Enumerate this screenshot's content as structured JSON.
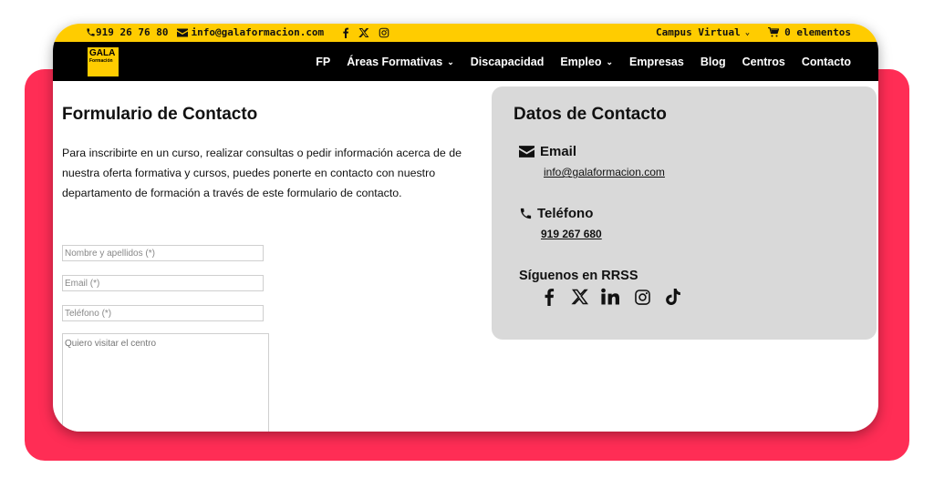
{
  "topbar": {
    "phone": "919 26 76 80",
    "email": "info@galaformacion.com",
    "campus": "Campus Virtual",
    "cart": "0 elementos"
  },
  "logo": {
    "line1": "GALA",
    "line2": "Formación"
  },
  "nav": {
    "items": [
      {
        "label": "FP",
        "dropdown": false
      },
      {
        "label": "Áreas Formativas",
        "dropdown": true
      },
      {
        "label": "Discapacidad",
        "dropdown": false
      },
      {
        "label": "Empleo",
        "dropdown": true
      },
      {
        "label": "Empresas",
        "dropdown": false
      },
      {
        "label": "Blog",
        "dropdown": false
      },
      {
        "label": "Centros",
        "dropdown": false
      },
      {
        "label": "Contacto",
        "dropdown": false
      }
    ]
  },
  "form": {
    "title": "Formulario de Contacto",
    "intro": "Para inscribirte en un curso, realizar consultas o pedir información acerca de de nuestra oferta formativa y cursos, puedes ponerte en contacto con nuestro departamento de formación a través de este formulario de contacto.",
    "name_placeholder": "Nombre y apellidos (*)",
    "email_placeholder": "Email (*)",
    "phone_placeholder": "Teléfono (*)",
    "message_placeholder": "Quiero visitar el centro"
  },
  "contact": {
    "title": "Datos de Contacto",
    "email_label": "Email",
    "email_value": "info@galaformacion.com",
    "phone_label": "Teléfono",
    "phone_value": "919 267 680",
    "social_label": "Síguenos en RRSS"
  },
  "colors": {
    "accent_yellow": "#ffcc00",
    "backdrop_pink": "#ff2d55",
    "panel_gray": "#d9d9d9",
    "nav_black": "#000000"
  }
}
